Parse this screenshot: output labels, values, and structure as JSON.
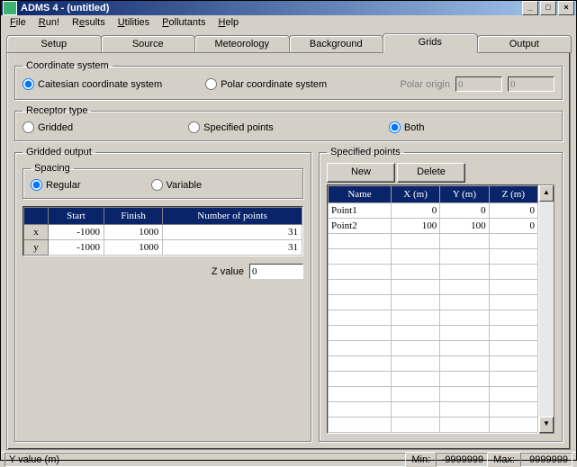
{
  "window": {
    "title": "ADMS 4 - (untitled)"
  },
  "menu": {
    "file": "File",
    "run": "Run!",
    "results": "Results",
    "utilities": "Utilities",
    "pollutants": "Pollutants",
    "help": "Help"
  },
  "tabs": {
    "setup": "Setup",
    "source": "Source",
    "meteorology": "Meteorology",
    "background": "Background",
    "grids": "Grids",
    "output": "Output"
  },
  "coord": {
    "legend": "Coordinate system",
    "cartesian": "Caitesian coordinate system",
    "polar": "Polar coordinate system",
    "origin_label": "Polar origin",
    "origin_x": "0",
    "origin_y": "0"
  },
  "receptor": {
    "legend": "Receptor type",
    "gridded": "Gridded",
    "specified": "Specified points",
    "both": "Both"
  },
  "gridded": {
    "legend": "Gridded output",
    "spacing_legend": "Spacing",
    "regular": "Regular",
    "variable": "Variable",
    "headers": {
      "axis": "",
      "start": "Start",
      "finish": "Finish",
      "npoints": "Number of points"
    },
    "rows": [
      {
        "axis": "x",
        "start": "-1000",
        "finish": "1000",
        "npoints": "31"
      },
      {
        "axis": "y",
        "start": "-1000",
        "finish": "1000",
        "npoints": "31"
      }
    ],
    "z_label": "Z value",
    "z_value": "0"
  },
  "specified": {
    "legend": "Specified points",
    "new_btn": "New",
    "delete_btn": "Delete",
    "headers": {
      "name": "Name",
      "x": "X (m)",
      "y": "Y (m)",
      "z": "Z (m)"
    },
    "rows": [
      {
        "name": "Point1",
        "x": "0",
        "y": "0",
        "z": "0"
      },
      {
        "name": "Point2",
        "x": "100",
        "y": "100",
        "z": "0"
      }
    ]
  },
  "status": {
    "field": "Y value (m)",
    "min_label": "Min:",
    "min": "-9999999",
    "max_label": "Max:",
    "max": "9999999"
  }
}
